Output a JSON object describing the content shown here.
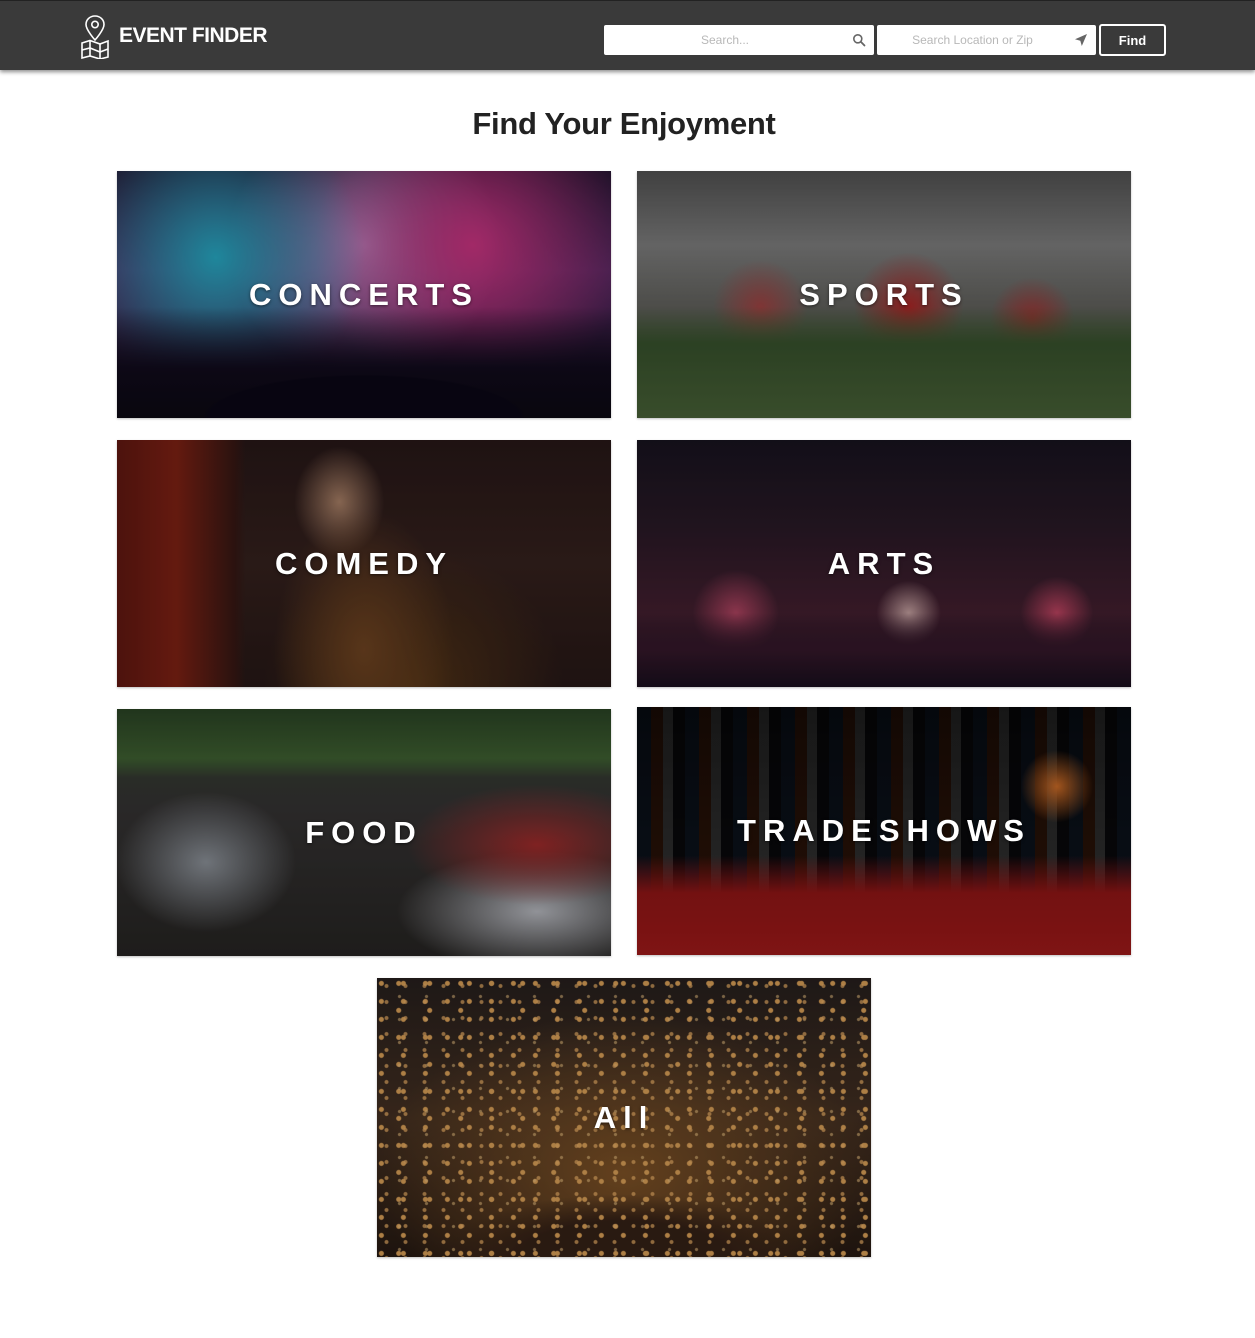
{
  "header": {
    "brand": "EVENT FINDER",
    "search_placeholder": "Search...",
    "location_placeholder": "Search Location or Zip",
    "find_label": "Find"
  },
  "main": {
    "title": "Find Your Enjoyment",
    "categories": [
      {
        "label": "CONCERTS"
      },
      {
        "label": "SPORTS"
      },
      {
        "label": "COMEDY"
      },
      {
        "label": "ARTS"
      },
      {
        "label": "FOOD"
      },
      {
        "label": "TRADESHOWS"
      },
      {
        "label": "All"
      }
    ]
  },
  "icons": {
    "brand": "map-pin-icon",
    "search": "search-icon",
    "location": "location-arrow-icon"
  },
  "colors": {
    "navbar": "#3a3a3a",
    "title_text": "#222222",
    "tile_label": "#ffffff"
  }
}
